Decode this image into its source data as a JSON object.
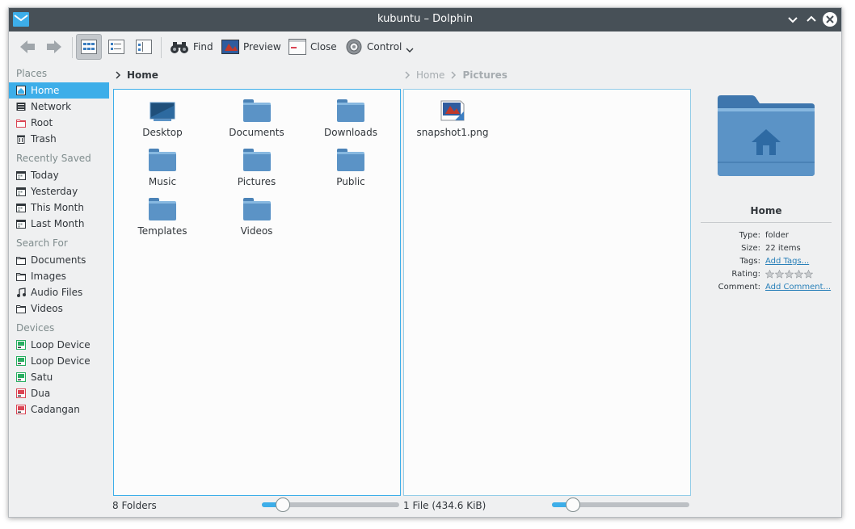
{
  "window": {
    "title": "kubuntu – Dolphin"
  },
  "toolbar": {
    "find": "Find",
    "preview": "Preview",
    "close": "Close",
    "control": "Control"
  },
  "places": {
    "groups": [
      {
        "title": "Places",
        "items": [
          {
            "label": "Home",
            "icon": "home-icon",
            "active": true
          },
          {
            "label": "Network",
            "icon": "network-icon"
          },
          {
            "label": "Root",
            "icon": "root-folder-icon"
          },
          {
            "label": "Trash",
            "icon": "trash-icon"
          }
        ]
      },
      {
        "title": "Recently Saved",
        "items": [
          {
            "label": "Today",
            "icon": "calendar-icon"
          },
          {
            "label": "Yesterday",
            "icon": "calendar-icon"
          },
          {
            "label": "This Month",
            "icon": "calendar-icon"
          },
          {
            "label": "Last Month",
            "icon": "calendar-icon"
          }
        ]
      },
      {
        "title": "Search For",
        "items": [
          {
            "label": "Documents",
            "icon": "folder-icon"
          },
          {
            "label": "Images",
            "icon": "folder-icon"
          },
          {
            "label": "Audio Files",
            "icon": "music-note-icon"
          },
          {
            "label": "Videos",
            "icon": "folder-icon"
          }
        ]
      },
      {
        "title": "Devices",
        "items": [
          {
            "label": "Loop Device",
            "icon": "drive-icon"
          },
          {
            "label": "Loop Device",
            "icon": "drive-icon"
          },
          {
            "label": "Satu",
            "icon": "drive-icon"
          },
          {
            "label": "Dua",
            "icon": "drive-red-icon"
          },
          {
            "label": "Cadangan",
            "icon": "drive-red-icon"
          }
        ]
      }
    ]
  },
  "left_pane": {
    "breadcrumb": "Home",
    "items": [
      {
        "label": "Desktop",
        "icon": "desktop-folder-icon"
      },
      {
        "label": "Documents",
        "icon": "documents-folder-icon"
      },
      {
        "label": "Downloads",
        "icon": "downloads-folder-icon"
      },
      {
        "label": "Music",
        "icon": "music-folder-icon"
      },
      {
        "label": "Pictures",
        "icon": "pictures-folder-icon"
      },
      {
        "label": "Public",
        "icon": "public-folder-icon"
      },
      {
        "label": "Templates",
        "icon": "templates-folder-icon"
      },
      {
        "label": "Videos",
        "icon": "videos-folder-icon"
      }
    ],
    "status": "8 Folders",
    "zoom_fraction": 0.15
  },
  "right_pane": {
    "breadcrumb_home": "Home",
    "breadcrumb_current": "Pictures",
    "items": [
      {
        "label": "snapshot1.png",
        "icon": "image-file-icon"
      }
    ],
    "status": "1 File (434.6 KiB)",
    "zoom_fraction": 0.15
  },
  "info_panel": {
    "name": "Home",
    "rows": {
      "type_label": "Type:",
      "type_value": "folder",
      "size_label": "Size:",
      "size_value": "22 items",
      "tags_label": "Tags:",
      "tags_value": "Add Tags...",
      "rating_label": "Rating:",
      "rating_value": 0,
      "comment_label": "Comment:",
      "comment_value": "Add Comment..."
    }
  },
  "colors": {
    "accent": "#3daee9",
    "titlebar": "#475057",
    "folder": "#5b93c6"
  }
}
